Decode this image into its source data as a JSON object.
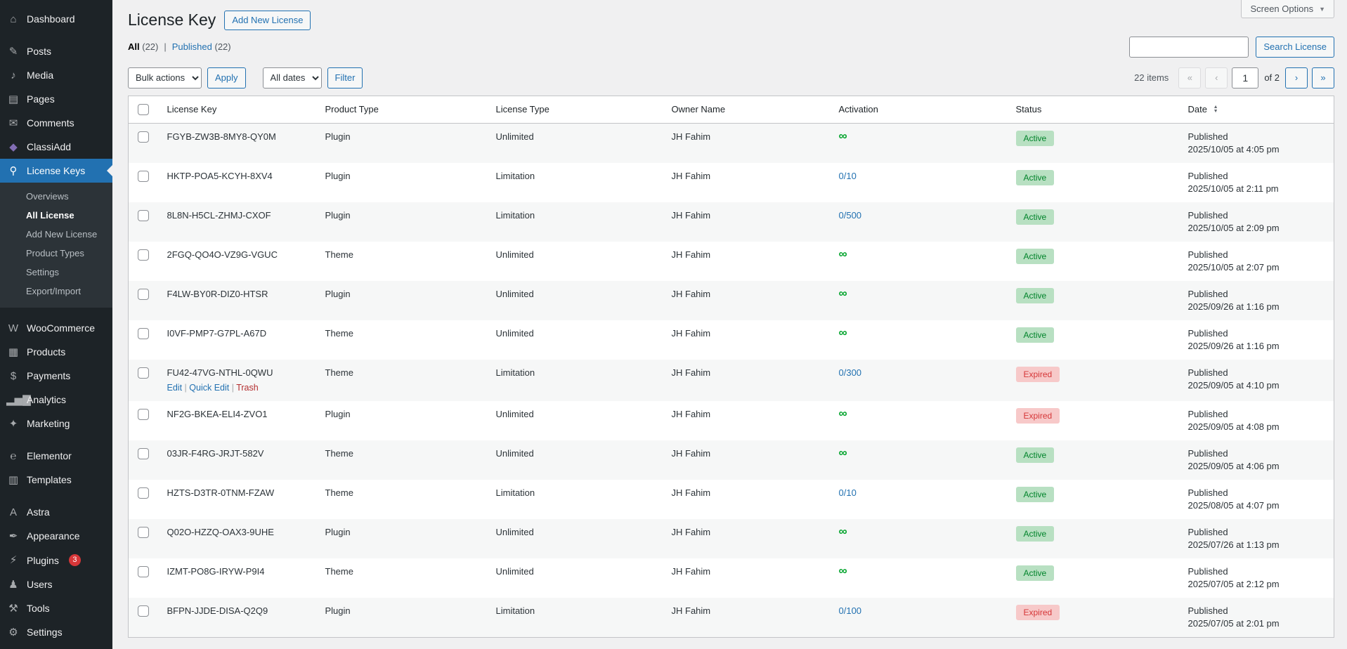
{
  "header": {
    "title": "License Key",
    "add_new_label": "Add New License",
    "screen_options_label": "Screen Options"
  },
  "icons": {
    "chevron_down": "▼",
    "sort_asc": "▲",
    "sort_desc": "▼"
  },
  "filters": {
    "all_label": "All",
    "all_count": "(22)",
    "separator": "|",
    "published_label": "Published",
    "published_count": "(22)",
    "search_button": "Search License",
    "bulk_actions": "Bulk actions",
    "apply": "Apply",
    "all_dates": "All dates",
    "filter": "Filter"
  },
  "pagination": {
    "items_count": "22 items",
    "first": "«",
    "prev": "‹",
    "current_page": "1",
    "of_label": "of 2",
    "next": "›",
    "last": "»"
  },
  "sidebar": {
    "items": [
      {
        "label": "Dashboard",
        "icon": "dashboard-icon",
        "name": "dashboard"
      },
      {
        "separator": true
      },
      {
        "label": "Posts",
        "icon": "posts-icon",
        "name": "posts"
      },
      {
        "label": "Media",
        "icon": "media-icon",
        "name": "media"
      },
      {
        "label": "Pages",
        "icon": "pages-icon",
        "name": "pages"
      },
      {
        "label": "Comments",
        "icon": "comments-icon",
        "name": "comments"
      },
      {
        "label": "ClassiAdd",
        "icon": "classiadd-icon",
        "name": "classiadd",
        "icon_color": "#826eb4"
      },
      {
        "label": "License Keys",
        "icon": "key-icon",
        "name": "license-keys",
        "active": true,
        "submenu": [
          {
            "label": "Overviews"
          },
          {
            "label": "All License",
            "current": true
          },
          {
            "label": "Add New License"
          },
          {
            "label": "Product Types"
          },
          {
            "label": "Settings"
          },
          {
            "label": "Export/Import"
          }
        ]
      },
      {
        "separator": true
      },
      {
        "label": "WooCommerce",
        "icon": "woocommerce-icon",
        "name": "woocommerce"
      },
      {
        "label": "Products",
        "icon": "products-icon",
        "name": "products"
      },
      {
        "label": "Payments",
        "icon": "payments-icon",
        "name": "payments"
      },
      {
        "label": "Analytics",
        "icon": "analytics-icon",
        "name": "analytics"
      },
      {
        "label": "Marketing",
        "icon": "marketing-icon",
        "name": "marketing"
      },
      {
        "separator": true
      },
      {
        "label": "Elementor",
        "icon": "elementor-icon",
        "name": "elementor"
      },
      {
        "label": "Templates",
        "icon": "templates-icon",
        "name": "templates"
      },
      {
        "separator": true
      },
      {
        "label": "Astra",
        "icon": "astra-icon",
        "name": "astra"
      },
      {
        "label": "Appearance",
        "icon": "appearance-icon",
        "name": "appearance"
      },
      {
        "label": "Plugins",
        "icon": "plugins-icon",
        "name": "plugins",
        "badge": "3"
      },
      {
        "label": "Users",
        "icon": "users-icon",
        "name": "users"
      },
      {
        "label": "Tools",
        "icon": "tools-icon",
        "name": "tools"
      },
      {
        "label": "Settings",
        "icon": "settings-icon",
        "name": "settings"
      }
    ]
  },
  "table": {
    "columns": [
      "License Key",
      "Product Type",
      "License Type",
      "Owner Name",
      "Activation",
      "Status",
      "Date"
    ],
    "row_actions": {
      "edit": "Edit",
      "quick_edit": "Quick Edit",
      "trash": "Trash",
      "separator": "|"
    },
    "rows": [
      {
        "key": "FGYB-ZW3B-8MY8-QY0M",
        "product_type": "Plugin",
        "license_type": "Unlimited",
        "owner": "JH Fahim",
        "activation": "∞",
        "activation_kind": "unlimited",
        "status": "Active",
        "date_line1": "Published",
        "date_line2": "2025/10/05 at 4:05 pm"
      },
      {
        "key": "HKTP-POA5-KCYH-8XV4",
        "product_type": "Plugin",
        "license_type": "Limitation",
        "owner": "JH Fahim",
        "activation": "0/10",
        "activation_kind": "limited",
        "status": "Active",
        "date_line1": "Published",
        "date_line2": "2025/10/05 at 2:11 pm"
      },
      {
        "key": "8L8N-H5CL-ZHMJ-CXOF",
        "product_type": "Plugin",
        "license_type": "Limitation",
        "owner": "JH Fahim",
        "activation": "0/500",
        "activation_kind": "limited",
        "status": "Active",
        "date_line1": "Published",
        "date_line2": "2025/10/05 at 2:09 pm"
      },
      {
        "key": "2FGQ-QO4O-VZ9G-VGUC",
        "product_type": "Theme",
        "license_type": "Unlimited",
        "owner": "JH Fahim",
        "activation": "∞",
        "activation_kind": "unlimited",
        "status": "Active",
        "date_line1": "Published",
        "date_line2": "2025/10/05 at 2:07 pm"
      },
      {
        "key": "F4LW-BY0R-DIZ0-HTSR",
        "product_type": "Plugin",
        "license_type": "Unlimited",
        "owner": "JH Fahim",
        "activation": "∞",
        "activation_kind": "unlimited",
        "status": "Active",
        "date_line1": "Published",
        "date_line2": "2025/09/26 at 1:16 pm"
      },
      {
        "key": "I0VF-PMP7-G7PL-A67D",
        "product_type": "Theme",
        "license_type": "Unlimited",
        "owner": "JH Fahim",
        "activation": "∞",
        "activation_kind": "unlimited",
        "status": "Active",
        "date_line1": "Published",
        "date_line2": "2025/09/26 at 1:16 pm"
      },
      {
        "key": "FU42-47VG-NTHL-0QWU",
        "product_type": "Theme",
        "license_type": "Limitation",
        "owner": "JH Fahim",
        "activation": "0/300",
        "activation_kind": "limited",
        "status": "Expired",
        "date_line1": "Published",
        "date_line2": "2025/09/05 at 4:10 pm",
        "show_actions": true
      },
      {
        "key": "NF2G-BKEA-ELI4-ZVO1",
        "product_type": "Plugin",
        "license_type": "Unlimited",
        "owner": "JH Fahim",
        "activation": "∞",
        "activation_kind": "unlimited",
        "status": "Expired",
        "date_line1": "Published",
        "date_line2": "2025/09/05 at 4:08 pm"
      },
      {
        "key": "03JR-F4RG-JRJT-582V",
        "product_type": "Theme",
        "license_type": "Unlimited",
        "owner": "JH Fahim",
        "activation": "∞",
        "activation_kind": "unlimited",
        "status": "Active",
        "date_line1": "Published",
        "date_line2": "2025/09/05 at 4:06 pm"
      },
      {
        "key": "HZTS-D3TR-0TNM-FZAW",
        "product_type": "Theme",
        "license_type": "Limitation",
        "owner": "JH Fahim",
        "activation": "0/10",
        "activation_kind": "limited",
        "status": "Active",
        "date_line1": "Published",
        "date_line2": "2025/08/05 at 4:07 pm"
      },
      {
        "key": "Q02O-HZZQ-OAX3-9UHE",
        "product_type": "Plugin",
        "license_type": "Unlimited",
        "owner": "JH Fahim",
        "activation": "∞",
        "activation_kind": "unlimited",
        "status": "Active",
        "date_line1": "Published",
        "date_line2": "2025/07/26 at 1:13 pm"
      },
      {
        "key": "IZMT-PO8G-IRYW-P9I4",
        "product_type": "Theme",
        "license_type": "Unlimited",
        "owner": "JH Fahim",
        "activation": "∞",
        "activation_kind": "unlimited",
        "status": "Active",
        "date_line1": "Published",
        "date_line2": "2025/07/05 at 2:12 pm"
      },
      {
        "key": "BFPN-JJDE-DISA-Q2Q9",
        "product_type": "Plugin",
        "license_type": "Limitation",
        "owner": "JH Fahim",
        "activation": "0/100",
        "activation_kind": "limited",
        "status": "Expired",
        "date_line1": "Published",
        "date_line2": "2025/07/05 at 2:01 pm"
      }
    ]
  },
  "colors": {
    "accent": "#2271b1",
    "sidebar_bg": "#1d2327",
    "submenu_bg": "#2c3338",
    "active_badge_bg": "#b8e0c2",
    "active_badge_text": "#00832a",
    "expired_badge_bg": "#f7c9c9",
    "expired_badge_text": "#d63638",
    "unlimited_green": "#00a32a",
    "plugins_badge_bg": "#d63638",
    "classiadd_icon": "#826eb4"
  }
}
